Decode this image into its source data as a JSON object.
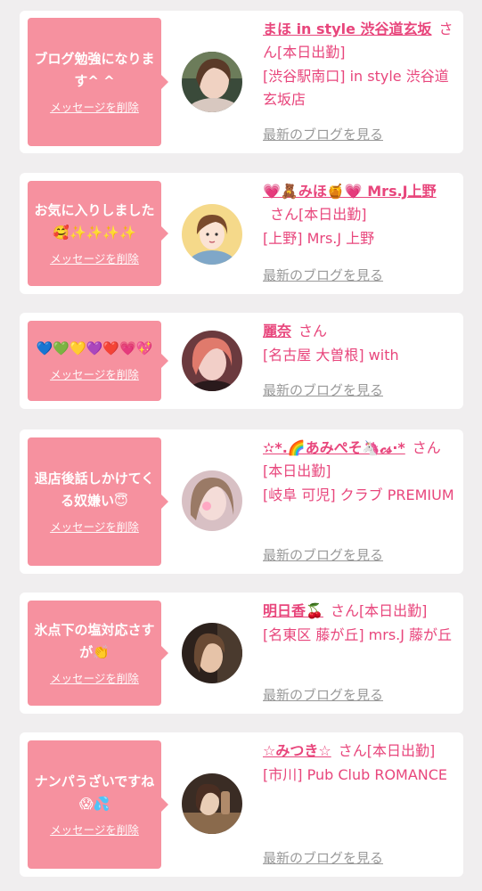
{
  "colors": {
    "accent": "#e8467c",
    "bubble": "#f6919f",
    "link_gray": "#999999",
    "background": "#f0eeef"
  },
  "delete_label": "メッセージを削除",
  "blog_label": "最新のブログを見る",
  "cards": [
    {
      "message": "ブログ勉強になります^ ^",
      "name": "まほ in style 渋谷道玄坂",
      "suffix": "さん[本日出勤]",
      "shop": "[渋谷駅南口] in style 渋谷道玄坂店",
      "avatar_icon": "woman-photo"
    },
    {
      "message": "お気に入りしました🥰✨✨✨✨",
      "name": "💗🧸みほ🍯💗 Mrs.J上野",
      "suffix": "さん[本日出勤]",
      "shop": "[上野] Mrs.J 上野",
      "avatar_icon": "illustrated-woman"
    },
    {
      "message": "💙💚💛💜❤️💗💖",
      "name": "麗奈",
      "suffix": "さん",
      "shop": "[名古屋 大曽根] with",
      "avatar_icon": "woman-photo"
    },
    {
      "message": "退店後話しかけてくる奴嫌い😇",
      "name": "✫*.🌈あみぺそ🦄𝓬𝓼·*",
      "suffix": "さん[本日出勤]",
      "shop": "[岐阜 可児] クラブ PREMIUM",
      "avatar_icon": "woman-photo"
    },
    {
      "message": "氷点下の塩対応さすが👏",
      "name": "明日香🍒",
      "suffix": "さん[本日出勤]",
      "shop": "[名東区 藤が丘] mrs.J 藤が丘",
      "avatar_icon": "woman-photo"
    },
    {
      "message": "ナンパうざいですね😱💦",
      "name": "☆みつき☆",
      "suffix": "さん[本日出勤]",
      "shop": "[市川] Pub Club ROMANCE",
      "avatar_icon": "woman-photo"
    }
  ]
}
